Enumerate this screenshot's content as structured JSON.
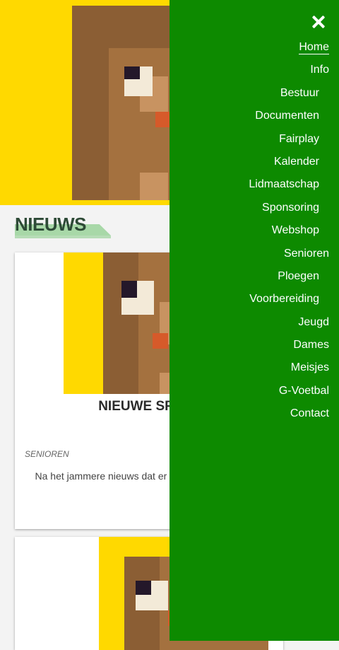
{
  "section": {
    "title": "NIEUWS"
  },
  "cards": [
    {
      "title": "NIEUWE SPELE",
      "category": "SENIOREN",
      "text": "Na het jammere nieuws dat er c wordt, beginnen we"
    }
  ],
  "menu": {
    "items": [
      {
        "label": "Home",
        "active": true
      },
      {
        "label": "Info"
      },
      {
        "label": "Bestuur"
      },
      {
        "label": "Documenten"
      },
      {
        "label": "Fairplay"
      },
      {
        "label": "Kalender"
      },
      {
        "label": "Lidmaatschap"
      },
      {
        "label": "Sponsoring"
      },
      {
        "label": "Webshop"
      },
      {
        "label": "Senioren"
      },
      {
        "label": "Ploegen"
      },
      {
        "label": "Voorbereiding"
      },
      {
        "label": "Jeugd"
      },
      {
        "label": "Dames"
      },
      {
        "label": "Meisjes"
      },
      {
        "label": "G-Voetbal"
      },
      {
        "label": "Contact"
      }
    ]
  },
  "colors": {
    "menu_bg": "#0d8a00",
    "hero_bg": "#ffd900",
    "mascot_brown": "#8b5e34"
  }
}
